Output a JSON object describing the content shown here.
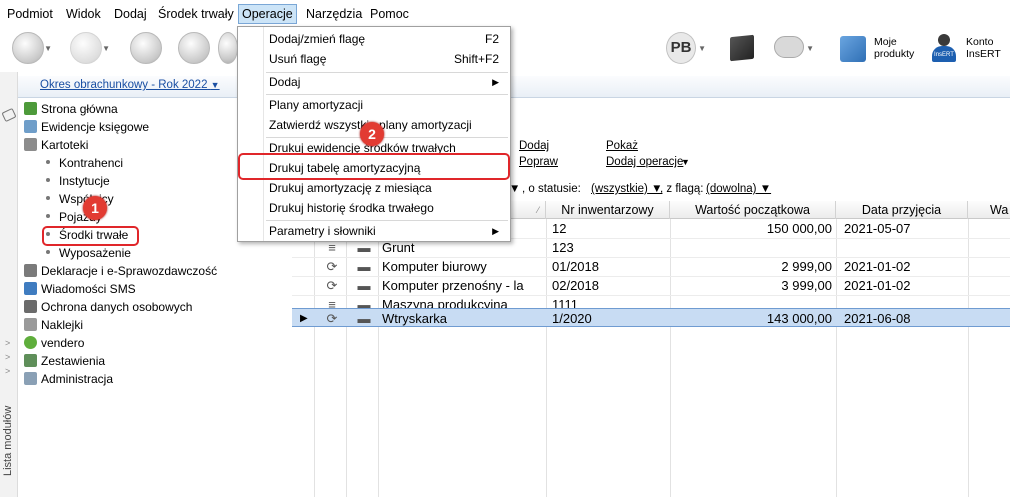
{
  "menubar": {
    "items": [
      {
        "label": "Podmiot"
      },
      {
        "label": "Widok"
      },
      {
        "label": "Dodaj"
      },
      {
        "label": "Środek trwały"
      },
      {
        "label": "Operacje"
      },
      {
        "label": "Narzędzia"
      },
      {
        "label": "Pomoc"
      }
    ]
  },
  "toolbar": {
    "pb_label": "PB",
    "moje_produkty": "Moje produkty",
    "moje_line1": "Moje",
    "moje_line2": "produkty",
    "konto_line1": "Konto",
    "konto_line2": "InsERT",
    "insert_logo": "InsERT"
  },
  "left": {
    "period": "Okres obrachunkowy - Rok 2022",
    "vertical_label": "Lista modułów",
    "items": [
      {
        "label": "Strona główna"
      },
      {
        "label": "Ewidencje księgowe"
      },
      {
        "label": "Kartoteki"
      },
      {
        "label": "Kontrahenci"
      },
      {
        "label": "Instytucje"
      },
      {
        "label": "Wspólnicy"
      },
      {
        "label": "Pojazdy"
      },
      {
        "label": "Środki trwałe"
      },
      {
        "label": "Wyposażenie"
      },
      {
        "label": "Deklaracje i e-Sprawozdawczość"
      },
      {
        "label": "Wiadomości SMS"
      },
      {
        "label": "Ochrona danych osobowych"
      },
      {
        "label": "Naklejki"
      },
      {
        "label": "vendero"
      },
      {
        "label": "Zestawienia"
      },
      {
        "label": "Administracja"
      }
    ]
  },
  "badges": {
    "one": "1",
    "two": "2"
  },
  "main": {
    "links": {
      "dodaj": "Dodaj",
      "popraw": "Popraw",
      "pokaz": "Pokaż",
      "dodaj_operacje": "Dodaj operacje"
    },
    "filter": {
      "status_label": ", o statusie:",
      "status_value": "(wszystkie)",
      "flag_label": ", z flagą:",
      "flag_value": "(dowolna)"
    }
  },
  "grid": {
    "headers": [
      "Nr inwentarzowy",
      "Wartość początkowa",
      "Data przyjęcia",
      "Wa"
    ],
    "rows": [
      {
        "name": "",
        "inv": "12",
        "value": "150 000,00",
        "date": "2021-05-07",
        "selected": false
      },
      {
        "name": "Grunt",
        "inv": "123",
        "value": "",
        "date": "",
        "selected": false
      },
      {
        "name": "Komputer biurowy",
        "inv": "01/2018",
        "value": "2 999,00",
        "date": "2021-01-02",
        "selected": false
      },
      {
        "name": "Komputer przenośny - la",
        "inv": "02/2018",
        "value": "3 999,00",
        "date": "2021-01-02",
        "selected": false
      },
      {
        "name": "Maszyna produkcyjna",
        "inv": "1111",
        "value": "",
        "date": "",
        "selected": false
      },
      {
        "name": "Wtryskarka",
        "inv": "1/2020",
        "value": "143 000,00",
        "date": "2021-06-08",
        "selected": true
      }
    ]
  },
  "dropdown": {
    "items": [
      {
        "label": "Dodaj/zmień flagę",
        "shortcut": "F2"
      },
      {
        "label": "Usuń flagę",
        "shortcut": "Shift+F2"
      },
      {
        "label": "Dodaj",
        "shortcut": ""
      },
      {
        "label": "Plany amortyzacji",
        "shortcut": ""
      },
      {
        "label": "Zatwierdź wszystkie plany amortyzacji",
        "shortcut": ""
      },
      {
        "label": "Drukuj ewidencję środków trwałych",
        "shortcut": ""
      },
      {
        "label": "Drukuj tabelę amortyzacyjną",
        "shortcut": ""
      },
      {
        "label": "Drukuj amortyzację z miesiąca",
        "shortcut": ""
      },
      {
        "label": "Drukuj historię środka trwałego",
        "shortcut": ""
      },
      {
        "label": "Parametry i słowniki",
        "shortcut": ""
      }
    ]
  },
  "colors": {
    "accent": "#1a4fa3",
    "highlight": "#e0262a",
    "selection": "#c8dcf3"
  }
}
